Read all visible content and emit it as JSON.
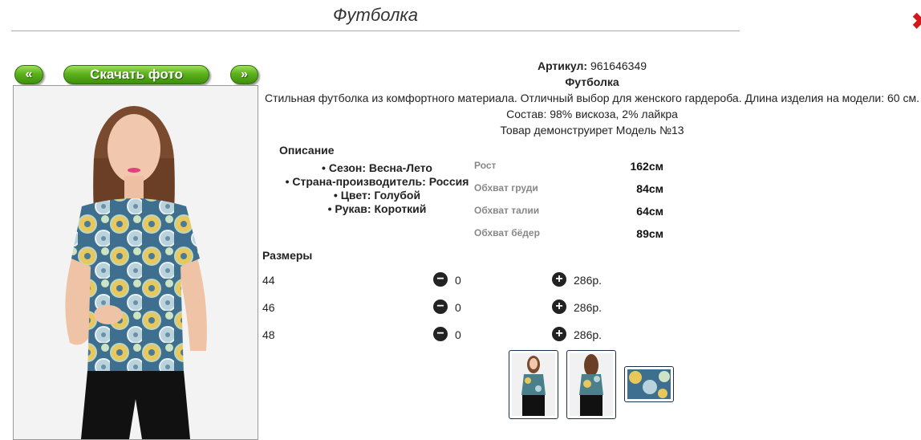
{
  "header": {
    "title": "Футболка",
    "close_icon": "close-icon"
  },
  "gallery": {
    "prev_label": "«",
    "download_label": "Скачать фото",
    "next_label": "»"
  },
  "product": {
    "sku_label": "Артикул:",
    "sku_value": "961646349",
    "name": "Футболка",
    "description": "Стильная футболка из комфортного материала. Отличный выбор для женского гардероба. Длина изделия на модели: 60 см. Состав: 98% вискоза, 2% лайкра",
    "model_line": "Товар демонструирет Модель №13"
  },
  "details": {
    "title": "Описание",
    "items": [
      "Сезон: Весна-Лето",
      "Страна-производитель: Россия",
      "Цвет: Голубой",
      "Рукав: Короткий"
    ]
  },
  "measurements": [
    {
      "label": "Рост",
      "value": "162см"
    },
    {
      "label": "Обхват груди",
      "value": "84см"
    },
    {
      "label": "Обхват талии",
      "value": "64см"
    },
    {
      "label": "Обхват бёдер",
      "value": "89см"
    }
  ],
  "sizes": {
    "title": "Размеры",
    "rows": [
      {
        "size": "44",
        "qty": "0",
        "price": "286р."
      },
      {
        "size": "46",
        "qty": "0",
        "price": "286р."
      },
      {
        "size": "48",
        "qty": "0",
        "price": "286р."
      }
    ]
  },
  "colors": {
    "accent_green": "#5cb11c",
    "close_red": "#d21818",
    "print_blue": "#3f6f8f",
    "print_yellow": "#e8c85a"
  }
}
